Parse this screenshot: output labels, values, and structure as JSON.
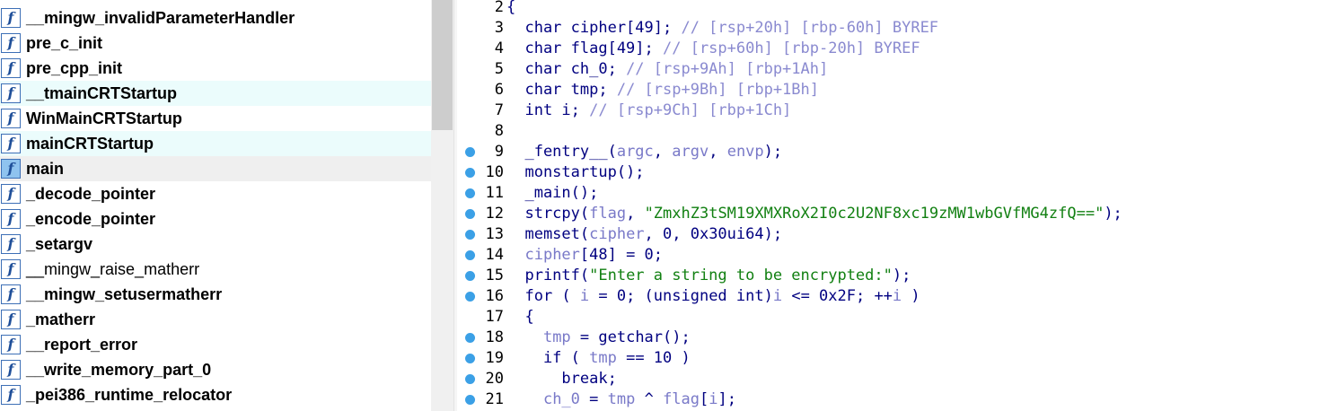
{
  "functions": [
    {
      "name": "__mingw_invalidParameterHandler",
      "bold": true,
      "highlight": "none"
    },
    {
      "name": "pre_c_init",
      "bold": true,
      "highlight": "none"
    },
    {
      "name": "pre_cpp_init",
      "bold": true,
      "highlight": "none"
    },
    {
      "name": "__tmainCRTStartup",
      "bold": true,
      "highlight": "cyan"
    },
    {
      "name": "WinMainCRTStartup",
      "bold": true,
      "highlight": "none"
    },
    {
      "name": "mainCRTStartup",
      "bold": true,
      "highlight": "cyan"
    },
    {
      "name": "main",
      "bold": true,
      "highlight": "gray",
      "selected": true
    },
    {
      "name": "_decode_pointer",
      "bold": true,
      "highlight": "none"
    },
    {
      "name": "_encode_pointer",
      "bold": true,
      "highlight": "none"
    },
    {
      "name": "_setargv",
      "bold": true,
      "highlight": "none"
    },
    {
      "name": "__mingw_raise_matherr",
      "bold": false,
      "highlight": "none"
    },
    {
      "name": "__mingw_setusermatherr",
      "bold": true,
      "highlight": "none"
    },
    {
      "name": "_matherr",
      "bold": true,
      "highlight": "none"
    },
    {
      "name": "__report_error",
      "bold": true,
      "highlight": "none"
    },
    {
      "name": "__write_memory_part_0",
      "bold": true,
      "highlight": "none"
    },
    {
      "name": "_pei386_runtime_relocator",
      "bold": true,
      "highlight": "none"
    }
  ],
  "function_icon_glyph": "f",
  "code_lines": [
    {
      "num": "2",
      "bp": false,
      "tokens": [
        [
          "p",
          "{"
        ]
      ]
    },
    {
      "num": "3",
      "bp": false,
      "tokens": [
        [
          "p",
          "  char cipher[49]; "
        ],
        [
          "c",
          "// [rsp+20h] [rbp-60h] BYREF"
        ]
      ]
    },
    {
      "num": "4",
      "bp": false,
      "tokens": [
        [
          "p",
          "  char flag[49]; "
        ],
        [
          "c",
          "// [rsp+60h] [rbp-20h] BYREF"
        ]
      ]
    },
    {
      "num": "5",
      "bp": false,
      "tokens": [
        [
          "p",
          "  char ch_0; "
        ],
        [
          "c",
          "// [rsp+9Ah] [rbp+1Ah]"
        ]
      ]
    },
    {
      "num": "6",
      "bp": false,
      "tokens": [
        [
          "p",
          "  char tmp; "
        ],
        [
          "c",
          "// [rsp+9Bh] [rbp+1Bh]"
        ]
      ]
    },
    {
      "num": "7",
      "bp": false,
      "tokens": [
        [
          "p",
          "  int i; "
        ],
        [
          "c",
          "// [rsp+9Ch] [rbp+1Ch]"
        ]
      ]
    },
    {
      "num": "8",
      "bp": false,
      "tokens": [
        [
          "p",
          ""
        ]
      ]
    },
    {
      "num": "9",
      "bp": true,
      "tokens": [
        [
          "p",
          "  _fentry__("
        ],
        [
          "v",
          "argc"
        ],
        [
          "p",
          ", "
        ],
        [
          "v",
          "argv"
        ],
        [
          "p",
          ", "
        ],
        [
          "v",
          "envp"
        ],
        [
          "p",
          ");"
        ]
      ]
    },
    {
      "num": "10",
      "bp": true,
      "tokens": [
        [
          "p",
          "  monstartup();"
        ]
      ]
    },
    {
      "num": "11",
      "bp": true,
      "tokens": [
        [
          "p",
          "  _main();"
        ]
      ]
    },
    {
      "num": "12",
      "bp": true,
      "tokens": [
        [
          "p",
          "  strcpy("
        ],
        [
          "v",
          "flag"
        ],
        [
          "p",
          ", "
        ],
        [
          "s",
          "\"ZmxhZ3tSM19XMXRoX2I0c2U2NF8xc19zMW1wbGVfMG4zfQ==\""
        ],
        [
          "p",
          ");"
        ]
      ]
    },
    {
      "num": "13",
      "bp": true,
      "tokens": [
        [
          "p",
          "  memset("
        ],
        [
          "v",
          "cipher"
        ],
        [
          "p",
          ", 0, 0x30ui64);"
        ]
      ]
    },
    {
      "num": "14",
      "bp": true,
      "tokens": [
        [
          "p",
          "  "
        ],
        [
          "v",
          "cipher"
        ],
        [
          "p",
          "[48] = 0;"
        ]
      ]
    },
    {
      "num": "15",
      "bp": true,
      "tokens": [
        [
          "p",
          "  printf("
        ],
        [
          "s",
          "\"Enter a string to be encrypted:\""
        ],
        [
          "p",
          ");"
        ]
      ]
    },
    {
      "num": "16",
      "bp": true,
      "tokens": [
        [
          "p",
          "  for ( "
        ],
        [
          "v",
          "i"
        ],
        [
          "p",
          " = 0; (unsigned int)"
        ],
        [
          "v",
          "i"
        ],
        [
          "p",
          " <= 0x2F; ++"
        ],
        [
          "v",
          "i"
        ],
        [
          "p",
          " )"
        ]
      ]
    },
    {
      "num": "17",
      "bp": false,
      "tokens": [
        [
          "p",
          "  {"
        ]
      ]
    },
    {
      "num": "18",
      "bp": true,
      "tokens": [
        [
          "p",
          "    "
        ],
        [
          "v",
          "tmp"
        ],
        [
          "p",
          " = getchar();"
        ]
      ]
    },
    {
      "num": "19",
      "bp": true,
      "tokens": [
        [
          "p",
          "    if ( "
        ],
        [
          "v",
          "tmp"
        ],
        [
          "p",
          " == 10 )"
        ]
      ]
    },
    {
      "num": "20",
      "bp": true,
      "tokens": [
        [
          "p",
          "      break;"
        ]
      ]
    },
    {
      "num": "21",
      "bp": true,
      "tokens": [
        [
          "p",
          "    "
        ],
        [
          "v",
          "ch_0"
        ],
        [
          "p",
          " = "
        ],
        [
          "v",
          "tmp"
        ],
        [
          "p",
          " ^ "
        ],
        [
          "v",
          "flag"
        ],
        [
          "p",
          "["
        ],
        [
          "v",
          "i"
        ],
        [
          "p",
          "];"
        ]
      ]
    }
  ]
}
